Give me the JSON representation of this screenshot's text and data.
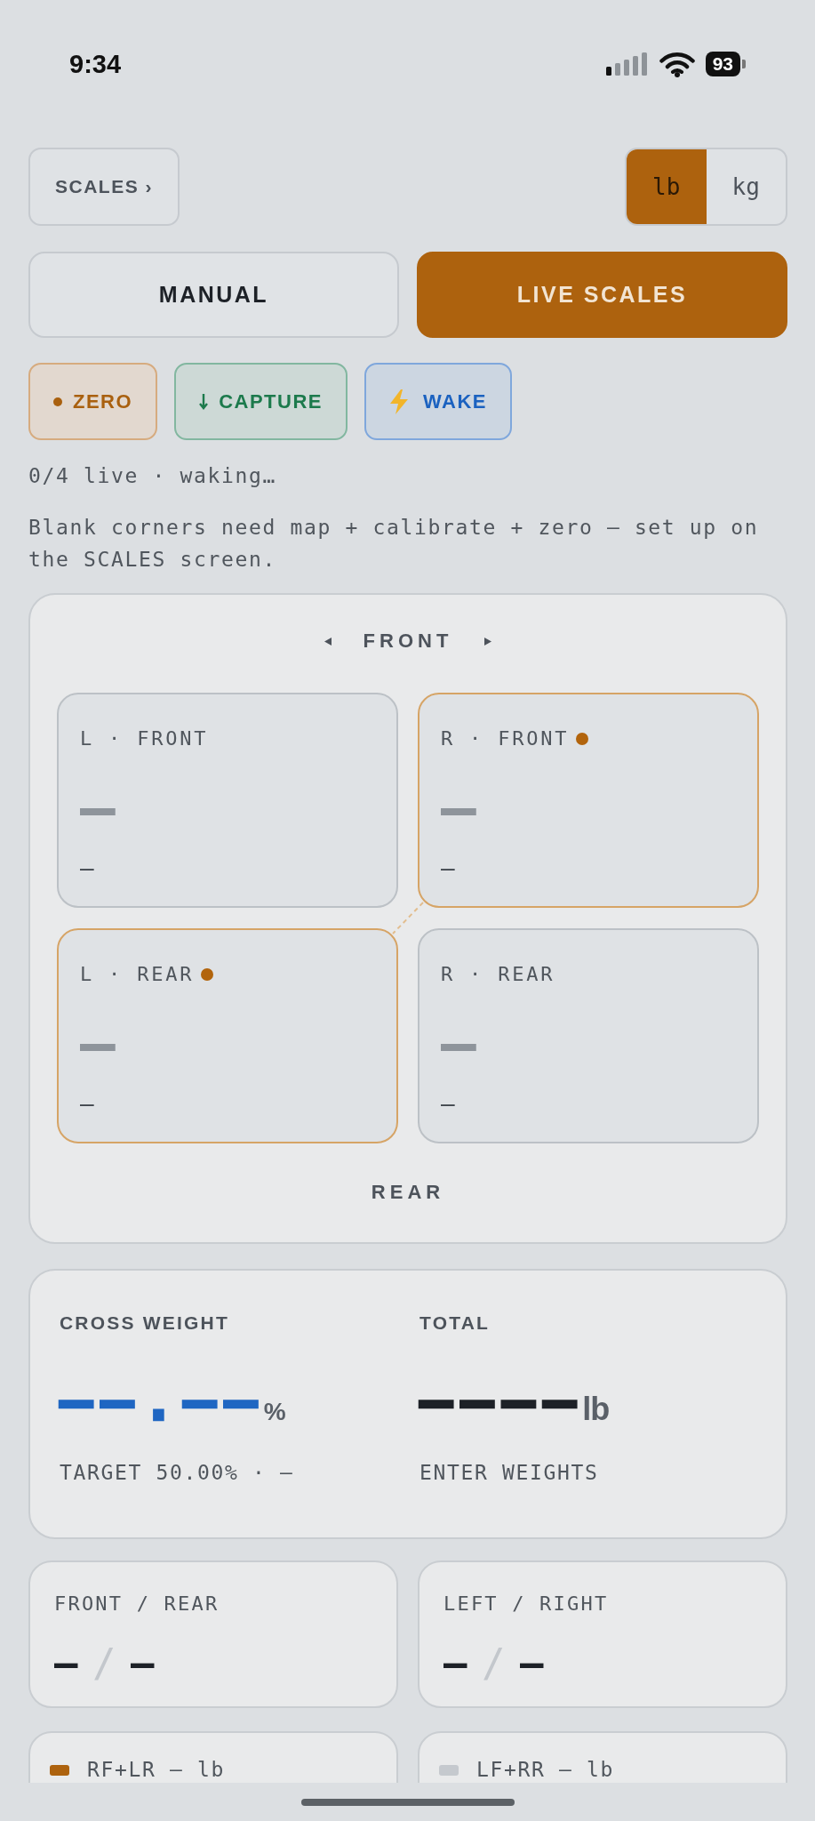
{
  "status_bar": {
    "time": "9:34",
    "battery": "93"
  },
  "header": {
    "scales_button": "SCALES ›",
    "units": [
      {
        "label": "lb",
        "selected": true
      },
      {
        "label": "kg",
        "selected": false
      }
    ]
  },
  "modes": [
    {
      "label": "MANUAL",
      "selected": false
    },
    {
      "label": "LIVE SCALES",
      "selected": true
    }
  ],
  "actions": [
    {
      "kind": "zero",
      "label": "ZERO"
    },
    {
      "kind": "capture",
      "label": "CAPTURE"
    },
    {
      "kind": "wake",
      "label": "WAKE"
    }
  ],
  "status": "0/4 live · waking…",
  "hint": "Blank corners need map + calibrate + zero — set up on the SCALES screen.",
  "corners": {
    "front_label": "FRONT",
    "rear_label": "REAR",
    "cells": [
      {
        "label": "L · FRONT",
        "highlighted": false,
        "weight": "—",
        "sub": "—"
      },
      {
        "label": "R · FRONT",
        "highlighted": true,
        "weight": "—",
        "sub": "—"
      },
      {
        "label": "L · REAR",
        "highlighted": true,
        "weight": "—",
        "sub": "—"
      },
      {
        "label": "R · REAR",
        "highlighted": false,
        "weight": "—",
        "sub": "—"
      }
    ]
  },
  "cross_weight": {
    "label": "CROSS WEIGHT",
    "value": "——.——",
    "unit": "%",
    "note": "TARGET 50.00% · —"
  },
  "total": {
    "label": "TOTAL",
    "value": "————",
    "unit": "lb",
    "note": "ENTER WEIGHTS"
  },
  "splits": [
    {
      "label": "FRONT / REAR",
      "values": [
        "—",
        "—"
      ],
      "separator": "/"
    },
    {
      "label": "LEFT / RIGHT",
      "values": [
        "—",
        "—"
      ],
      "separator": "/"
    }
  ],
  "diagonals": [
    {
      "label": "RF+LR — lb",
      "color": "#ad620e"
    },
    {
      "label": "LF+RR — lb",
      "color": "#c5c9ce"
    }
  ]
}
